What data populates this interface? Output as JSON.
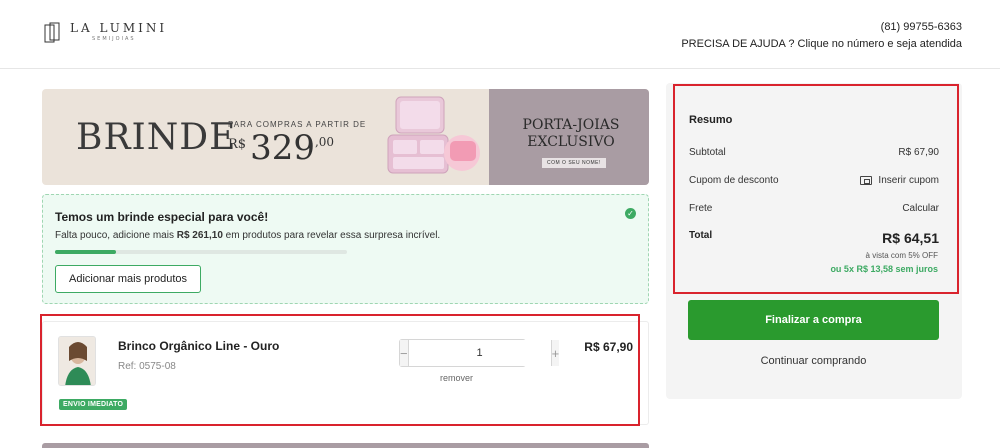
{
  "header": {
    "logo_name": "LA LUMINI",
    "logo_sub": "SEMIJOIAS",
    "phone": "(81) 99755-6363",
    "help_text": "PRECISA DE AJUDA ? Clique no número e seja atendida"
  },
  "banner": {
    "headline": "BRINDE",
    "promo_line": "PARA COMPRAS A PARTIR DE",
    "currency": "R$",
    "price_int": "329",
    "price_dec": ",00",
    "gift_title": "PORTA-JOIAS EXCLUSIVO",
    "gift_sub": "COM O SEU NOME!"
  },
  "gift_progress": {
    "title": "Temos um brinde especial para você!",
    "text_before": "Falta pouco, adicione mais ",
    "amount": "R$ 261,10",
    "text_after": " em produtos para revelar essa surpresa incrível.",
    "progress_fraction": 0.21,
    "button_label": "Adicionar mais produtos"
  },
  "cart": {
    "items": [
      {
        "name": "Brinco Orgânico Line - Ouro",
        "ref": "Ref: 0575-08",
        "quantity": "1",
        "price": "R$ 67,90",
        "remove_label": "remover",
        "badge": "ENVIO IMEDIATO"
      }
    ]
  },
  "summary": {
    "title": "Resumo",
    "subtotal_label": "Subtotal",
    "subtotal_value": "R$ 67,90",
    "coupon_label": "Cupom de desconto",
    "coupon_action": "Inserir cupom",
    "shipping_label": "Frete",
    "shipping_action": "Calcular",
    "total_label": "Total",
    "total_value": "R$ 64,51",
    "cash_note": "à vista com 5% OFF",
    "installments": "ou 5x R$ 13,58 sem juros",
    "checkout_label": "Finalizar a compra",
    "continue_label": "Continuar comprando"
  },
  "colors": {
    "accent_green": "#3daa63",
    "checkout_green": "#2a9a2e",
    "highlight_red": "#d9232d"
  }
}
